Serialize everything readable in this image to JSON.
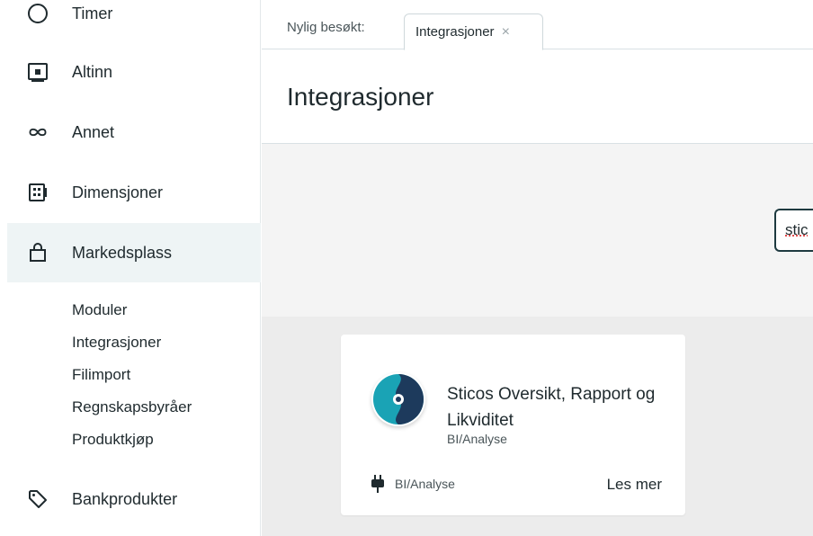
{
  "sidebar": {
    "items": [
      {
        "label": "Timer",
        "icon": "clock-icon"
      },
      {
        "label": "Altinn",
        "icon": "altinn-icon"
      },
      {
        "label": "Annet",
        "icon": "infinity-icon"
      },
      {
        "label": "Dimensjoner",
        "icon": "dimensions-icon"
      },
      {
        "label": "Markedsplass",
        "icon": "shopping-bag-icon"
      },
      {
        "label": "Bankprodukter",
        "icon": "tag-icon"
      }
    ],
    "sub_items": [
      "Moduler",
      "Integrasjoner",
      "Filimport",
      "Regnskapsbyråer",
      "Produktkjøp"
    ]
  },
  "tabbar": {
    "recent_label": "Nylig besøkt:",
    "tab_label": "Integrasjoner",
    "tab_close": "×"
  },
  "header": {
    "title": "Integrasjoner"
  },
  "search": {
    "value": "stic"
  },
  "card": {
    "title": "Sticos Oversikt, Rapport og Likviditet",
    "subtitle": "BI/Analyse",
    "category": "BI/Analyse",
    "read_more": "Les mer",
    "logo": "sticos-logo",
    "colors": {
      "logo_teal": "#1aa3b5",
      "logo_navy": "#1d3a5c"
    }
  }
}
